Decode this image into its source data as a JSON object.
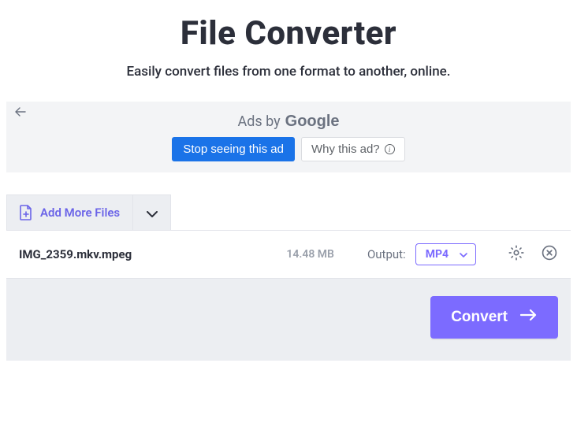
{
  "header": {
    "title": "File Converter",
    "subtitle": "Easily convert files from one format to another, online."
  },
  "ad": {
    "label_prefix": "Ads by",
    "label_brand": "Google",
    "stop_label": "Stop seeing this ad",
    "why_label": "Why this ad?"
  },
  "toolbar": {
    "add_more_label": "Add More Files"
  },
  "file": {
    "name": "IMG_2359.mkv.mpeg",
    "size": "14.48 MB",
    "output_label": "Output:",
    "output_value": "MP4"
  },
  "actions": {
    "convert_label": "Convert"
  }
}
